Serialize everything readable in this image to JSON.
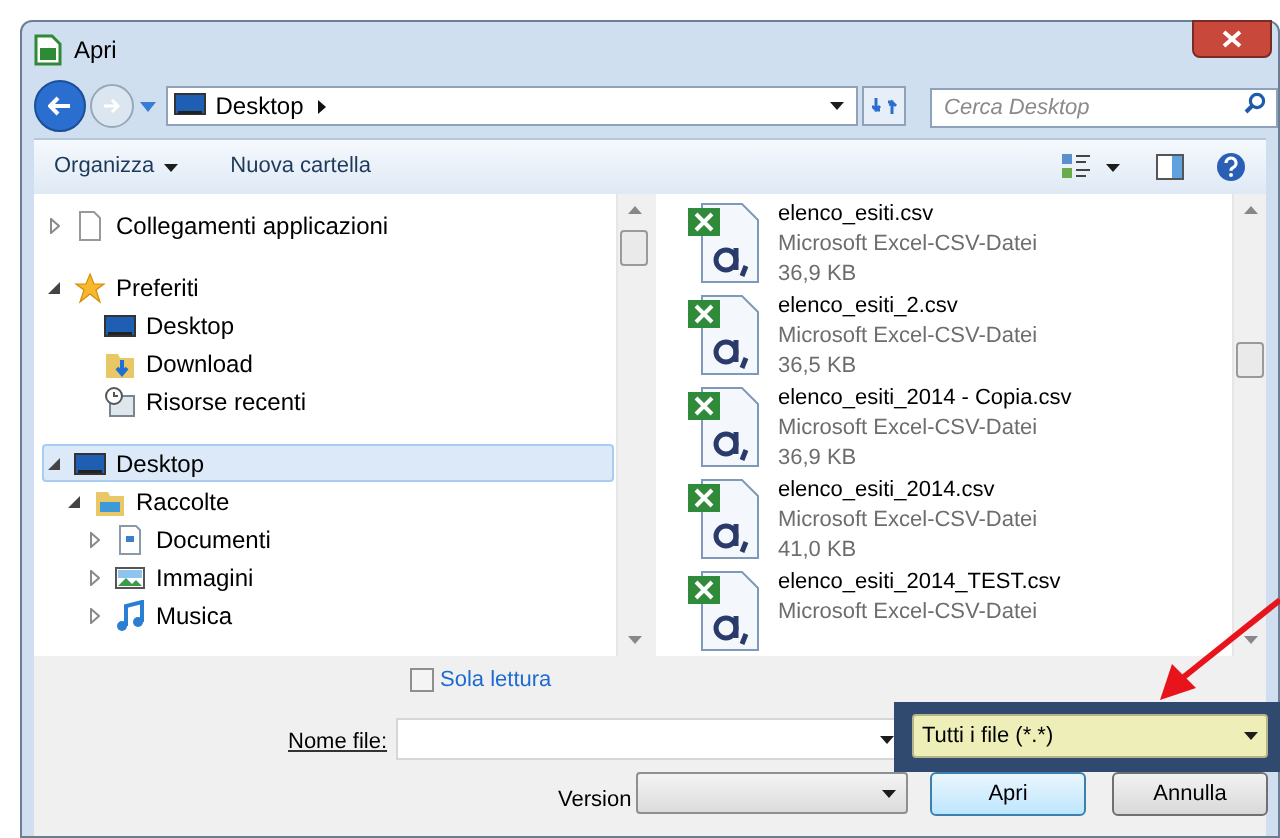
{
  "window": {
    "title": "Apri"
  },
  "address_bar": {
    "location": "Desktop"
  },
  "search": {
    "placeholder": "Cerca Desktop"
  },
  "toolbar": {
    "organize": "Organizza",
    "new_folder": "Nuova cartella"
  },
  "navigation": [
    {
      "label": "Collegamenti applicazioni",
      "kind": "page",
      "expanded": false,
      "selected": false
    },
    {
      "label": "Preferiti",
      "kind": "star",
      "expanded": true,
      "selected": false,
      "children": [
        {
          "label": "Desktop",
          "kind": "desktop",
          "selected": false
        },
        {
          "label": "Download",
          "kind": "download",
          "selected": false
        },
        {
          "label": "Risorse recenti",
          "kind": "recent",
          "selected": false
        }
      ]
    },
    {
      "label": "Desktop",
      "kind": "desktop",
      "expanded": true,
      "selected": true,
      "children": [
        {
          "label": "Raccolte",
          "kind": "library",
          "expanded": true,
          "selected": false,
          "children": [
            {
              "label": "Documenti",
              "kind": "document",
              "expanded": false,
              "selected": false
            },
            {
              "label": "Immagini",
              "kind": "image",
              "expanded": false,
              "selected": false
            },
            {
              "label": "Musica",
              "kind": "music",
              "expanded": false,
              "selected": false
            }
          ]
        }
      ]
    }
  ],
  "files": [
    {
      "name": "elenco_esiti.csv",
      "type": "Microsoft Excel-CSV-Datei",
      "size": "36,9 KB"
    },
    {
      "name": "elenco_esiti_2.csv",
      "type": "Microsoft Excel-CSV-Datei",
      "size": "36,5 KB"
    },
    {
      "name": "elenco_esiti_2014 - Copia.csv",
      "type": "Microsoft Excel-CSV-Datei",
      "size": "36,9 KB"
    },
    {
      "name": "elenco_esiti_2014.csv",
      "type": "Microsoft Excel-CSV-Datei",
      "size": "41,0 KB"
    },
    {
      "name": "elenco_esiti_2014_TEST.csv",
      "type": "Microsoft Excel-CSV-Datei"
    }
  ],
  "read_only": {
    "label": "Sola lettura",
    "checked": false
  },
  "file_name": {
    "label": "Nome file:"
  },
  "file_type": {
    "value": "Tutti i file (*.*)",
    "highlighted": true
  },
  "version": {
    "label": "Version"
  },
  "buttons": [
    {
      "label": "Apri",
      "default": true
    },
    {
      "label": "Annulla",
      "default": false
    }
  ]
}
